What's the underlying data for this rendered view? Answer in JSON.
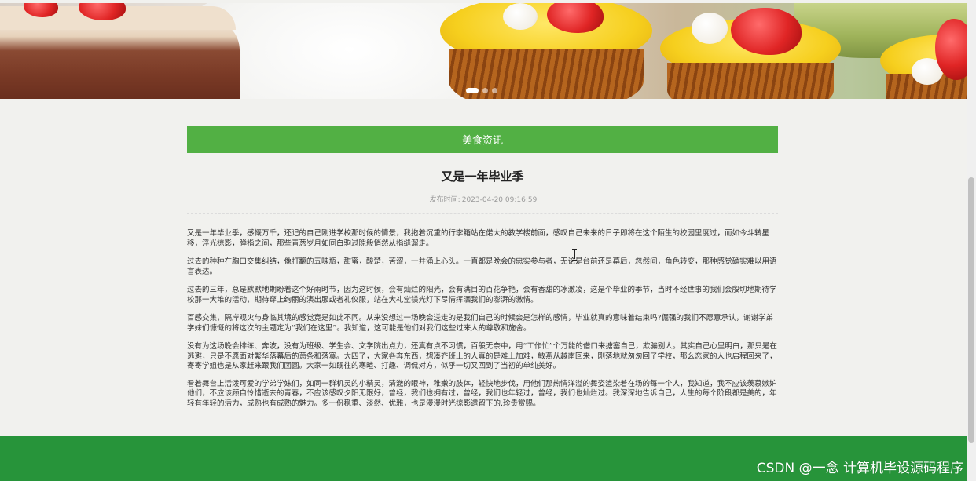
{
  "banner": {
    "slides_count": 3,
    "active_slide": 1
  },
  "section": {
    "header_label": "美食资讯",
    "color": "#52b044"
  },
  "article": {
    "title": "又是一年毕业季",
    "publish_label": "发布时间:",
    "publish_time": "2023-04-20 09:16:59",
    "paragraphs": [
      "又是一年毕业季，感慨万千，还记的自己刚进学校那时候的情景，我拖着沉重的行李箱站在偌大的教学楼前面，感叹自己未来的日子即将在这个陌生的校园里度过，而如今斗转星移，浮光掠影，弹指之间，那些青葱岁月如同白驹过隙般悄然从指缝溜走。",
      "过去的种种在胸口交集纠结，像打翻的五味瓶，甜蜜，酸楚，苦涩，一并涌上心头。一直都是晚会的忠实参与者，无论是台前还是幕后，忽然间，角色转变，那种感觉确实难以用语言表达。",
      "过去的三年，总是默默地期盼着这个好雨时节，因为这时候，会有灿烂的阳光，会有满目的百花争艳，会有香甜的冰激凌，这是个毕业的季节，当时不经世事的我们会殷切地期待学校那一大堆的活动，期待穿上绚丽的演出服或者礼仪服，站在大礼堂镁光灯下尽情挥洒我们的澎湃的激情。",
      "百感交集，隔岸观火与身临其境的感觉竟是如此不同。从来没想过一场晚会送走的是我们自己的时候会是怎样的感情，毕业就真的意味着结束吗?倔强的我们不愿意承认，谢谢学弟学妹们慷慨的将这次的主题定为“我们在这里”。我知道，这可能是他们对我们这些过来人的尊敬和施舍。",
      "没有为这场晚会排练、奔波，没有为班级、学生会、文学院出点力，还真有点不习惯，百般无奈中，用“工作忙”个万能的借口来搪塞自己，欺骗别人。其实自己心里明白，那只是在逃避，只是不愿面对繁华落幕后的萧条和落寞。大四了，大家各奔东西，想凑齐班上的人真的是难上加难，敏燕从越南回来，刚落地就匆匆回了学校，那么恋家的人也启程回来了，寄寄学姐也是从家赶来跟我们团圆。大家一如既往的寒暄、打趣、调侃对方，似乎一切又回到了当初的单纯美好。",
      "看着舞台上活泼可爱的学弟学妹们，如同一群机灵的小精灵，清澈的眼神，稚嫩的肢体，轻快地步伐，用他们那热情洋溢的舞姿渲染着在场的每一个人，我知道，我不应该羡慕嫉妒他们，不应该顾自怜惜逝去的青春，不应该感叹夕阳无限好，曾经，我们也拥有过，曾经，我们也年轻过，曾经，我们也灿烂过。我深深地告诉自己，人生的每个阶段都是美的，年轻有年轻的活力，成熟也有成熟的魅力。多一份稳重、淡然、优雅，也是漫漫时光掠影遗留下的.珍贵赏赐。"
    ]
  },
  "footer": {
    "color": "#27943a"
  },
  "watermark": {
    "text": "CSDN @一念 计算机毕设源码程序"
  }
}
